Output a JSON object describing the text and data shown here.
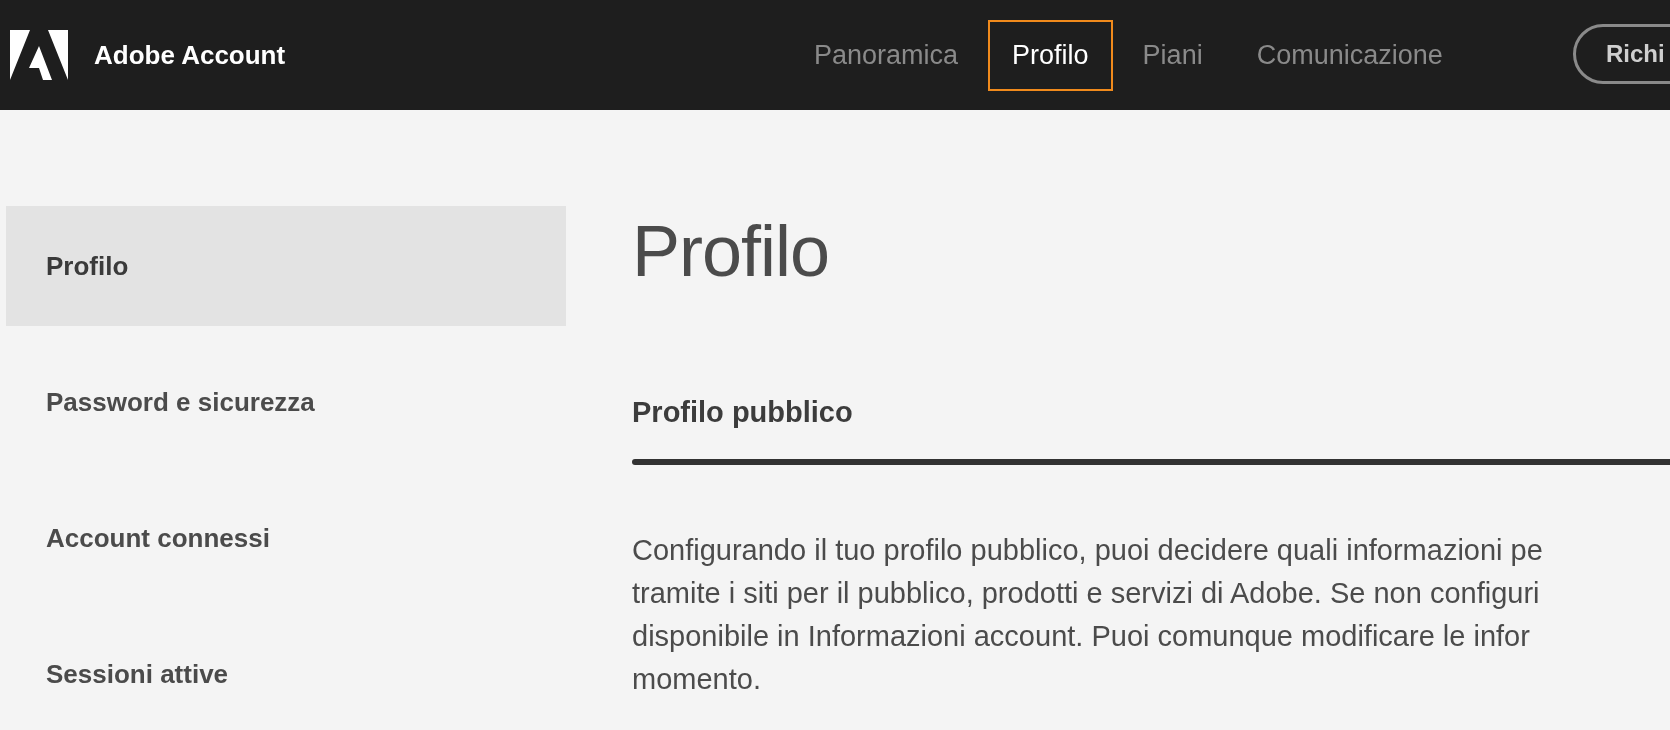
{
  "header": {
    "brand": "Adobe Account",
    "nav": [
      {
        "label": "Panoramica",
        "selected": false
      },
      {
        "label": "Profilo",
        "selected": true
      },
      {
        "label": "Piani",
        "selected": false
      },
      {
        "label": "Comunicazione",
        "selected": false
      }
    ],
    "button": "Richi"
  },
  "sidebar": {
    "items": [
      {
        "label": "Profilo",
        "selected": true
      },
      {
        "label": "Password e sicurezza",
        "selected": false
      },
      {
        "label": "Account connessi",
        "selected": false
      },
      {
        "label": "Sessioni attive",
        "selected": false
      }
    ]
  },
  "main": {
    "title": "Profilo",
    "section": "Profilo pubblico",
    "paragraph_lines": [
      "Configurando il tuo profilo pubblico, puoi decidere quali informazioni pe",
      "tramite i siti per il pubblico, prodotti e servizi di Adobe. Se non configuri",
      "disponibile in Informazioni account. Puoi comunque modificare le infor",
      "momento."
    ]
  }
}
